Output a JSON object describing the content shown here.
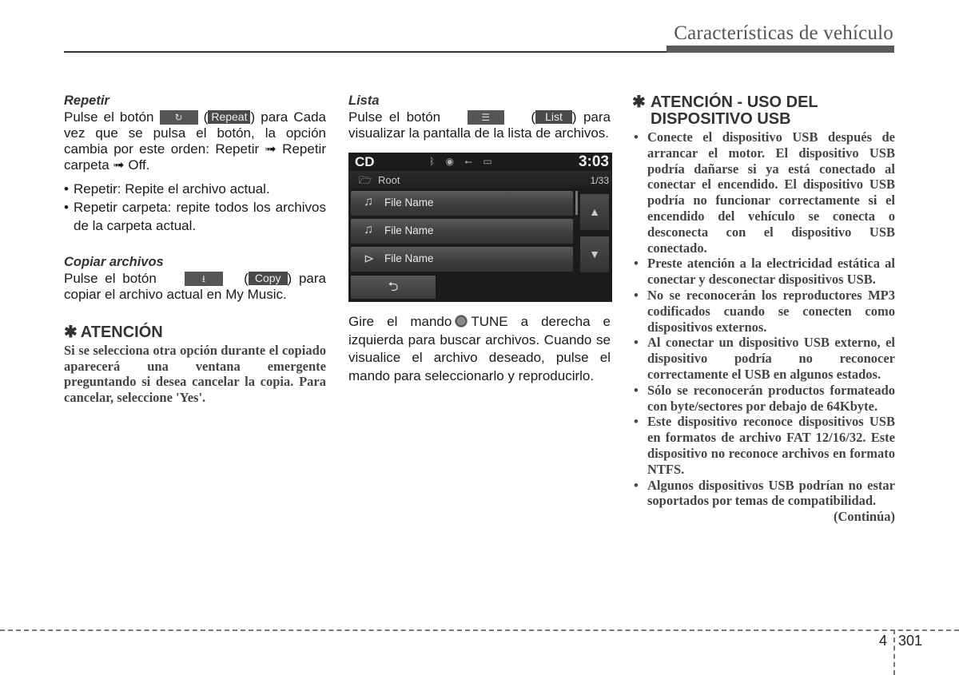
{
  "header": {
    "title": "Características de vehículo"
  },
  "col1": {
    "repeat": {
      "heading": "Repetir",
      "text_before": "Pulse el botón",
      "button_icon": "repeat-icon",
      "button_glyph": "↻",
      "tag": "Repeat",
      "text_after": ") para Cada vez que se pulsa el botón, la opción cambia por este orden: Repetir ➟ Repetir carpeta ➟ Off.",
      "bullets": [
        "Repetir: Repite el archivo actual.",
        "Repetir carpeta: repite todos los archivos de la carpeta actual."
      ]
    },
    "copy": {
      "heading": "Copiar archivos",
      "text_before": "Pulse el botón",
      "button_icon": "copy-icon",
      "button_glyph": "⭳",
      "tag": "Copy",
      "text_after": ") para copiar el archivo actual en My Music."
    },
    "attention": {
      "star": "✱",
      "heading": "ATENCIÓN",
      "body": "Si se selecciona otra opción durante el copiado aparecerá una ventana emergente preguntando si desea cancelar la copia. Para cancelar, seleccione 'Yes'."
    }
  },
  "col2": {
    "list": {
      "heading": "Lista",
      "text_before": "Pulse el botón",
      "button_icon": "list-icon",
      "button_glyph": "☰",
      "tag": "List",
      "text_after": ") para visualizar la pantalla de la lista de archivos."
    },
    "screen": {
      "source": "CD",
      "clock": "3:03",
      "status_icons": [
        "bluetooth-icon",
        "disc-icon",
        "usb-icon",
        "aux-icon"
      ],
      "status_glyphs": [
        "ᛒ",
        "◉",
        "⭠",
        "▭"
      ],
      "folder_glyph": "🗁",
      "path": "Root",
      "track_count": "1/33",
      "files": [
        {
          "icon": "music-note-icon",
          "glyph": "♫",
          "name": "File Name"
        },
        {
          "icon": "music-note-icon",
          "glyph": "♫",
          "name": "File Name"
        },
        {
          "icon": "play-circle-icon",
          "glyph": "⊳",
          "name": "File Name"
        }
      ],
      "up_glyph": "▲",
      "down_glyph": "▼",
      "back_glyph": "⮌"
    },
    "tune_text_before": "Gire el mando",
    "tune_text_after": "TUNE a derecha e izquierda para buscar archivos. Cuando se visualice el archivo deseado, pulse el mando para seleccionarlo y reproducirlo."
  },
  "col3": {
    "star": "✱",
    "heading": "ATENCIÓN - USO DEL DISPOSITIVO USB",
    "bullets": [
      "Conecte el dispositivo USB después de arrancar el motor. El dispositivo USB podría dañarse si ya está conectado al conectar el encendido. El dispositivo USB podría no funcionar correctamente si el encendido del vehículo se conecta o desconecta con el dispositivo USB conectado.",
      "Preste atención a la electricidad estática al conectar y desconectar dispositivos USB.",
      "No se reconocerán los reproductores MP3 codificados cuando se conecten como dispositivos externos.",
      "Al conectar un dispositivo USB externo, el dispositivo podría no reconocer correctamente el USB en algunos estados.",
      "Sólo se reconocerán productos formateado con byte/sectores por debajo de 64Kbyte.",
      "Este dispositivo reconoce dispositivos USB en formatos de archivo FAT 12/16/32. Este dispositivo no reconoce archivos en formato NTFS.",
      "Algunos dispositivos USB podrían no estar soportados por temas de compatibilidad."
    ],
    "continued": "(Continúa)"
  },
  "footer": {
    "chapter": "4",
    "page": "301"
  }
}
